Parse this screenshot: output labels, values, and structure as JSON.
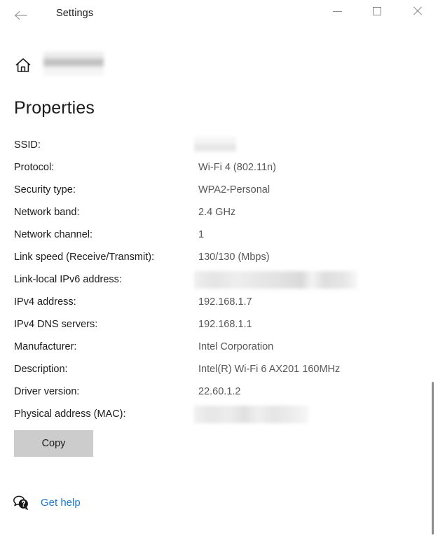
{
  "window": {
    "title": "Settings",
    "back_icon": "back-arrow-icon",
    "minimize_label": "Minimize",
    "maximize_label": "Maximize",
    "close_label": "Close"
  },
  "breadcrumb": {
    "home_icon": "home-icon",
    "redacted_label": ""
  },
  "page": {
    "title": "Properties"
  },
  "properties": [
    {
      "label": "SSID:",
      "value": "",
      "redacted": "ssid"
    },
    {
      "label": "Protocol:",
      "value": "Wi-Fi 4 (802.11n)",
      "redacted": ""
    },
    {
      "label": "Security type:",
      "value": "WPA2-Personal",
      "redacted": ""
    },
    {
      "label": "Network band:",
      "value": "2.4 GHz",
      "redacted": ""
    },
    {
      "label": "Network channel:",
      "value": "1",
      "redacted": ""
    },
    {
      "label": "Link speed (Receive/Transmit):",
      "value": "130/130 (Mbps)",
      "redacted": ""
    },
    {
      "label": "Link-local IPv6 address:",
      "value": "",
      "redacted": "ipv6"
    },
    {
      "label": "IPv4 address:",
      "value": "192.168.1.7",
      "redacted": ""
    },
    {
      "label": "IPv4 DNS servers:",
      "value": "192.168.1.1",
      "redacted": ""
    },
    {
      "label": "Manufacturer:",
      "value": "Intel Corporation",
      "redacted": ""
    },
    {
      "label": "Description:",
      "value": "Intel(R) Wi-Fi 6 AX201 160MHz",
      "redacted": ""
    },
    {
      "label": "Driver version:",
      "value": "22.60.1.2",
      "redacted": ""
    },
    {
      "label": "Physical address (MAC):",
      "value": "",
      "redacted": "mac"
    }
  ],
  "actions": {
    "copy_label": "Copy"
  },
  "help": {
    "icon": "help-chat-icon",
    "link_label": "Get help"
  },
  "colors": {
    "accent_link": "#1a79d4",
    "button_background": "#cccccc",
    "label_text": "#1b1b1b",
    "value_text": "#575757",
    "scrollbar_thumb": "#8e8e8e"
  }
}
